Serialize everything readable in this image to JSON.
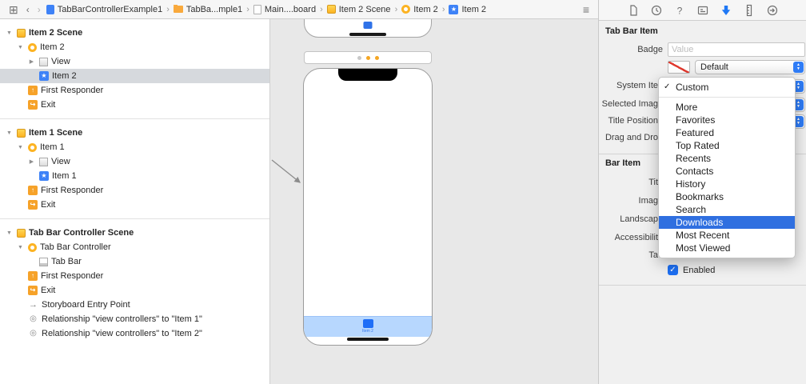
{
  "jump_bar": {
    "icons": [
      "related-items-icon",
      "back-icon",
      "forward-icon",
      "editor-list-icon"
    ],
    "breadcrumbs": [
      {
        "icon": "project-file-icon",
        "label": "TabBarControllerExample1"
      },
      {
        "icon": "folder-icon",
        "label": "TabBa...mple1"
      },
      {
        "icon": "storyboard-file-icon",
        "label": "Main....board"
      },
      {
        "icon": "scene-icon",
        "label": "Item 2 Scene"
      },
      {
        "icon": "view-controller-icon",
        "label": "Item 2"
      },
      {
        "icon": "tab-bar-item-icon",
        "label": "Item 2"
      }
    ]
  },
  "outline": {
    "items": [
      {
        "label": "Item 2 Scene",
        "indent": 0,
        "bold": true,
        "disclosure": "down",
        "icon": "scene-icon"
      },
      {
        "label": "Item 2",
        "indent": 1,
        "disclosure": "down",
        "icon": "view-controller-icon"
      },
      {
        "label": "View",
        "indent": 2,
        "disclosure": "right",
        "icon": "view-icon"
      },
      {
        "label": "Item 2",
        "indent": 2,
        "icon": "tab-bar-item-icon",
        "selected": true
      },
      {
        "label": "First Responder",
        "indent": 1,
        "icon": "first-responder-icon"
      },
      {
        "label": "Exit",
        "indent": 1,
        "icon": "exit-icon"
      },
      {
        "divider": true
      },
      {
        "label": "Item 1 Scene",
        "indent": 0,
        "bold": true,
        "disclosure": "down",
        "icon": "scene-icon"
      },
      {
        "label": "Item 1",
        "indent": 1,
        "disclosure": "down",
        "icon": "view-controller-icon"
      },
      {
        "label": "View",
        "indent": 2,
        "disclosure": "right",
        "icon": "view-icon"
      },
      {
        "label": "Item 1",
        "indent": 2,
        "icon": "tab-bar-item-icon"
      },
      {
        "label": "First Responder",
        "indent": 1,
        "icon": "first-responder-icon"
      },
      {
        "label": "Exit",
        "indent": 1,
        "icon": "exit-icon"
      },
      {
        "divider": true
      },
      {
        "label": "Tab Bar Controller Scene",
        "indent": 0,
        "bold": true,
        "disclosure": "down",
        "icon": "scene-icon"
      },
      {
        "label": "Tab Bar Controller",
        "indent": 1,
        "disclosure": "down",
        "icon": "view-controller-icon"
      },
      {
        "label": "Tab Bar",
        "indent": 2,
        "icon": "tab-bar-icon"
      },
      {
        "label": "First Responder",
        "indent": 1,
        "icon": "first-responder-icon"
      },
      {
        "label": "Exit",
        "indent": 1,
        "icon": "exit-icon"
      },
      {
        "label": "Storyboard Entry Point",
        "indent": 1,
        "icon": "entry-point-icon"
      },
      {
        "label": "Relationship \"view controllers\" to \"Item 1\"",
        "indent": 1,
        "icon": "relationship-icon"
      },
      {
        "label": "Relationship \"view controllers\" to \"Item 2\"",
        "indent": 1,
        "icon": "relationship-icon"
      }
    ]
  },
  "canvas": {
    "tab_item_label": "Item 2"
  },
  "inspector": {
    "tabs": [
      "file-inspector-icon",
      "history-inspector-icon",
      "quick-help-icon",
      "identity-inspector-icon",
      "attributes-inspector-icon",
      "size-inspector-icon",
      "connections-inspector-icon"
    ],
    "active_tab": "attributes-inspector-icon",
    "section_tab_bar_item": "Tab Bar Item",
    "badge_label": "Badge",
    "badge_placeholder": "Value",
    "badge_color_value": "Default",
    "popup_rows": [
      "System Ite",
      "Selected Imag",
      "Title Position",
      "Drag and Dro"
    ],
    "section_bar_item": "Bar Item",
    "bar_rows": [
      "Tit",
      "Imag",
      "Landscap",
      "Accessibilit",
      "Ta"
    ],
    "enabled_label": "Enabled"
  },
  "menu": {
    "items": [
      {
        "label": "Custom",
        "checked": true
      },
      {
        "separator": true
      },
      {
        "label": "More"
      },
      {
        "label": "Favorites"
      },
      {
        "label": "Featured"
      },
      {
        "label": "Top Rated"
      },
      {
        "label": "Recents"
      },
      {
        "label": "Contacts"
      },
      {
        "label": "History"
      },
      {
        "label": "Bookmarks"
      },
      {
        "label": "Search"
      },
      {
        "label": "Downloads",
        "highlighted": true
      },
      {
        "label": "Most Recent"
      },
      {
        "label": "Most Viewed"
      }
    ]
  }
}
